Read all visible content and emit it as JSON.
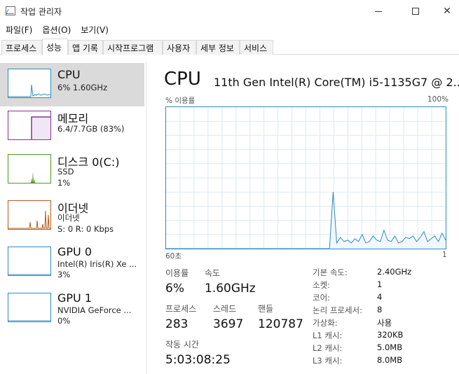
{
  "window": {
    "title": "작업 관리자"
  },
  "menu": [
    "파일(F)",
    "옵션(O)",
    "보기(V)"
  ],
  "tabs": [
    {
      "label": "프로세스"
    },
    {
      "label": "성능",
      "active": true
    },
    {
      "label": "앱 기록"
    },
    {
      "label": "시작프로그램"
    },
    {
      "label": "사용자"
    },
    {
      "label": "세부 정보"
    },
    {
      "label": "서비스"
    }
  ],
  "resources": [
    {
      "name": "CPU",
      "lines": [
        "6% 1.60GHz"
      ],
      "color": "#2e8bc0",
      "selected": true
    },
    {
      "name": "메모리",
      "lines": [
        "6.4/7.7GB (83%)"
      ],
      "color": "#8b2e9c"
    },
    {
      "name": "디스크 0(C:)",
      "lines": [
        "SSD",
        "1%"
      ],
      "color": "#4e9a1e"
    },
    {
      "name": "이더넷",
      "lines": [
        "이더넷",
        "S: 0 R: 0 Kbps"
      ],
      "color": "#b85c1a"
    },
    {
      "name": "GPU 0",
      "lines": [
        "Intel(R) Iris(R) Xe ...",
        "3%"
      ],
      "color": "#2e8bc0"
    },
    {
      "name": "GPU 1",
      "lines": [
        "NVIDIA GeForce ...",
        "0%"
      ],
      "color": "#2e8bc0"
    }
  ],
  "main": {
    "title": "CPU",
    "model": "11th Gen Intel(R) Core(TM) i5-1135G7 @ 2...",
    "graph": {
      "y_label": "% 이용률",
      "y_max_label": "100%",
      "x_left_label": "60초",
      "x_right_label": "1",
      "color": "#2e8bc0",
      "values": [
        0,
        0,
        0,
        0,
        0,
        0,
        0,
        0,
        0,
        0,
        0,
        0,
        0,
        0,
        0,
        0,
        0,
        0,
        0,
        0,
        0,
        0,
        0,
        0,
        0,
        0,
        0,
        0,
        0,
        0,
        0,
        0,
        0,
        0,
        0,
        0,
        0,
        0,
        0,
        0,
        0,
        0,
        0,
        0,
        0,
        0,
        40,
        4,
        8,
        5,
        6,
        4,
        7,
        5,
        10,
        4,
        5,
        9,
        6,
        5,
        13,
        6,
        5,
        9,
        4,
        5,
        8,
        7,
        9,
        5,
        8,
        12,
        5,
        7,
        9,
        5,
        11,
        6
      ]
    },
    "stats": {
      "utilization": {
        "label": "이용률",
        "value": "6%"
      },
      "speed": {
        "label": "속도",
        "value": "1.60GHz"
      },
      "processes": {
        "label": "프로세스",
        "value": "283"
      },
      "threads": {
        "label": "스레드",
        "value": "3697"
      },
      "handles": {
        "label": "핸들",
        "value": "120787"
      },
      "uptime": {
        "label": "작동 시간",
        "value": "5:03:08:25"
      }
    },
    "specs": [
      {
        "label": "기본 속도:",
        "value": "2.40GHz"
      },
      {
        "label": "소켓:",
        "value": "1"
      },
      {
        "label": "코어:",
        "value": "4"
      },
      {
        "label": "논리 프로세서:",
        "value": "8"
      },
      {
        "label": "가상화:",
        "value": "사용"
      },
      {
        "label": "L1 캐시:",
        "value": "320KB"
      },
      {
        "label": "L2 캐시:",
        "value": "5.0MB"
      },
      {
        "label": "L3 캐시:",
        "value": "8.0MB"
      }
    ]
  }
}
